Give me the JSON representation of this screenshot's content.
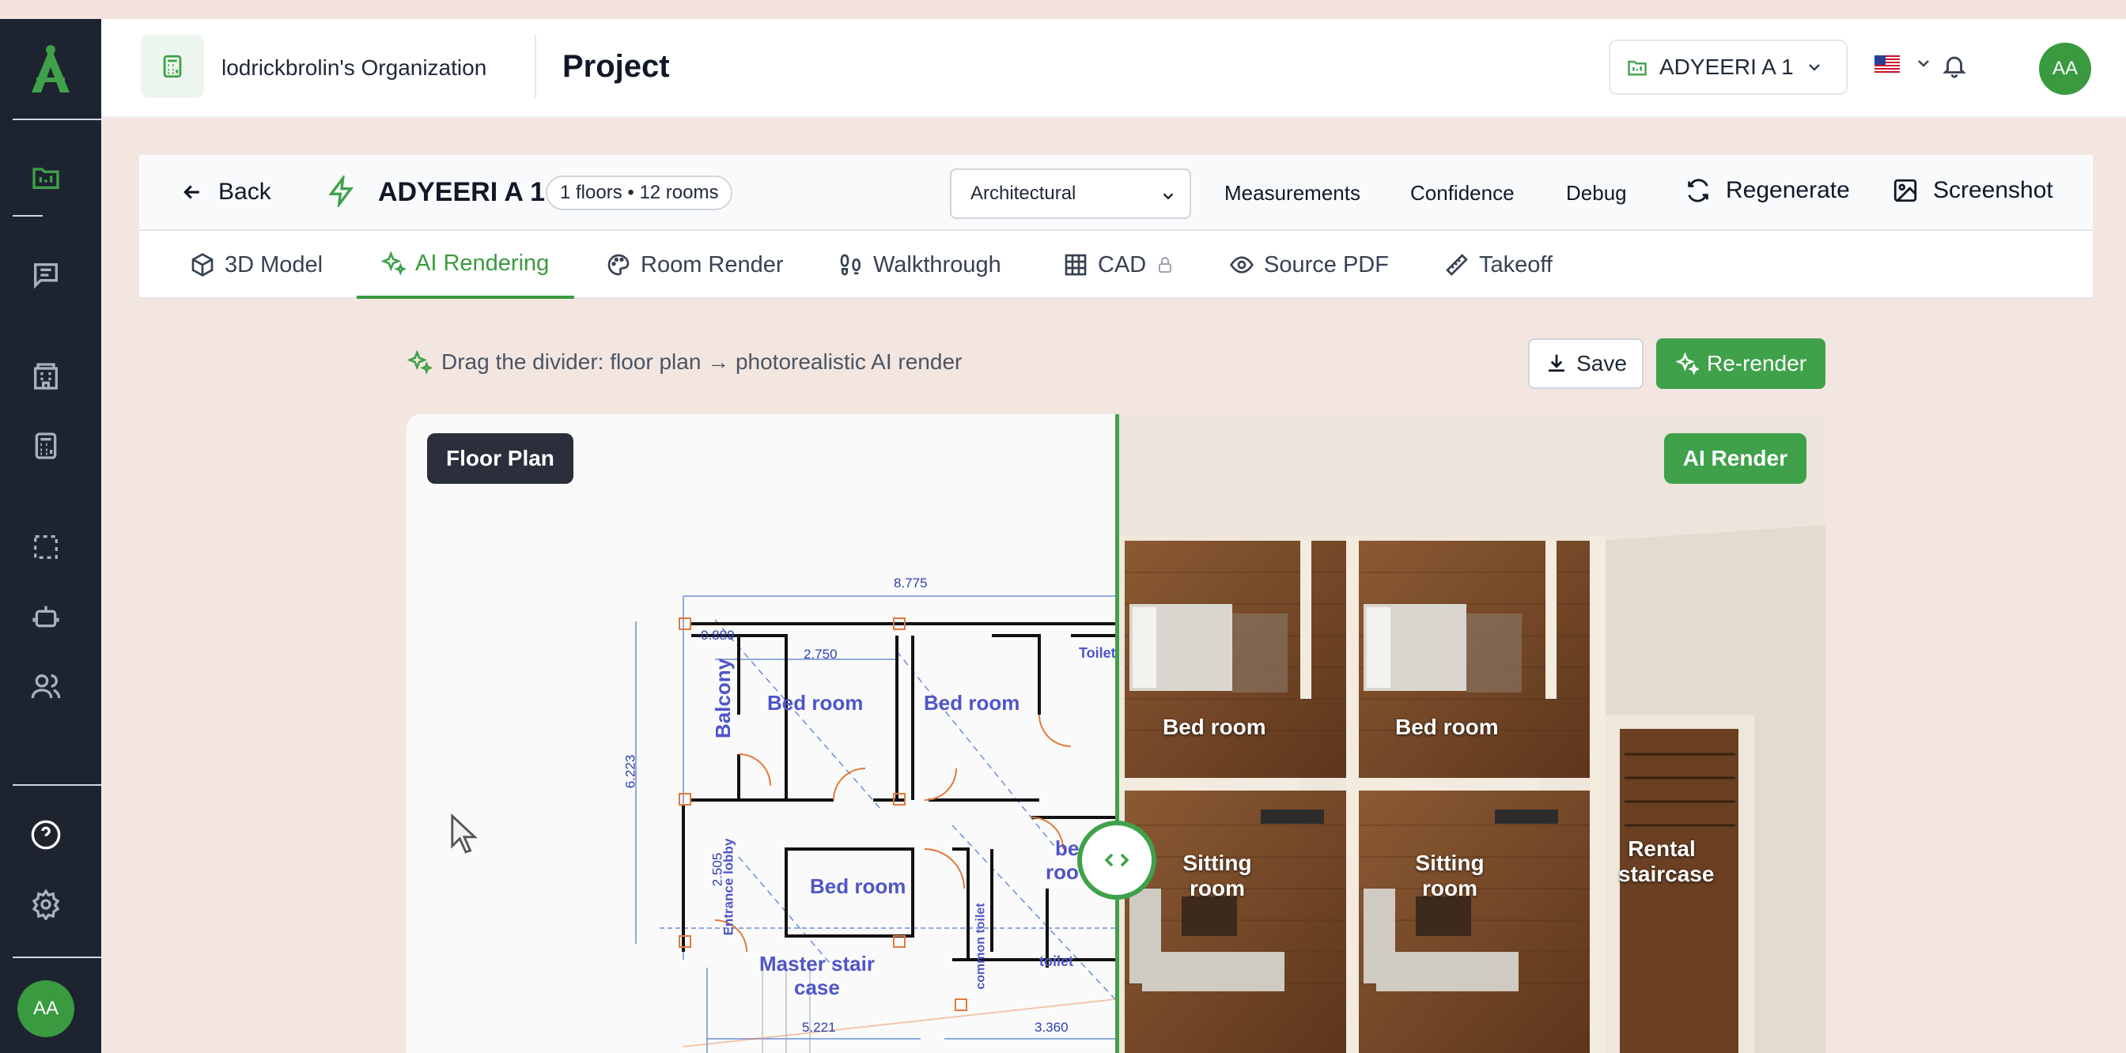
{
  "header": {
    "org_name": "lodrickbrolin's Organization",
    "page_title": "Project",
    "project_select": "ADYEERI A 1",
    "avatar_initials": "AA"
  },
  "sidebar": {
    "avatar_initials": "AA"
  },
  "toolbar": {
    "back_label": "Back",
    "model_name": "ADYEERI A 1",
    "model_badge": "1 floors • 12 rooms",
    "discipline_select": "Architectural",
    "links": [
      "Measurements",
      "Confidence",
      "Debug"
    ],
    "regenerate_label": "Regenerate",
    "screenshot_label": "Screenshot"
  },
  "tabs": [
    {
      "label": "3D Model"
    },
    {
      "label": "AI Rendering"
    },
    {
      "label": "Room Render"
    },
    {
      "label": "Walkthrough"
    },
    {
      "label": "CAD"
    },
    {
      "label": "Source PDF"
    },
    {
      "label": "Takeoff"
    }
  ],
  "render": {
    "hint": "Drag the divider: floor plan → photorealistic AI render",
    "save_label": "Save",
    "rerender_label": "Re-render",
    "left_pill": "Floor Plan",
    "right_pill": "AI Render"
  },
  "floor_plan": {
    "labels": {
      "balcony": "Balcony",
      "bed1": "Bed room",
      "bed2": "Bed room",
      "bed3": "Bed room",
      "bed4": "be",
      "bed4b": "roo",
      "toilet_top": "Toilet",
      "lobby": "Entrance lobby",
      "stair": "Master stair",
      "stair2": "case",
      "common_toilet": "common toilet",
      "toilet": "toilet"
    },
    "dims": [
      "8.775",
      "0.889",
      "2.750",
      "6.223",
      "2.505",
      "5.221",
      "3.360"
    ]
  },
  "ai_render": {
    "rooms": [
      "Bed room",
      "Bed room",
      "Sitting room",
      "Sitting room",
      "Rental staircase"
    ]
  },
  "colors": {
    "accent": "#3fa14a",
    "sidebar_bg": "#1e2330"
  }
}
